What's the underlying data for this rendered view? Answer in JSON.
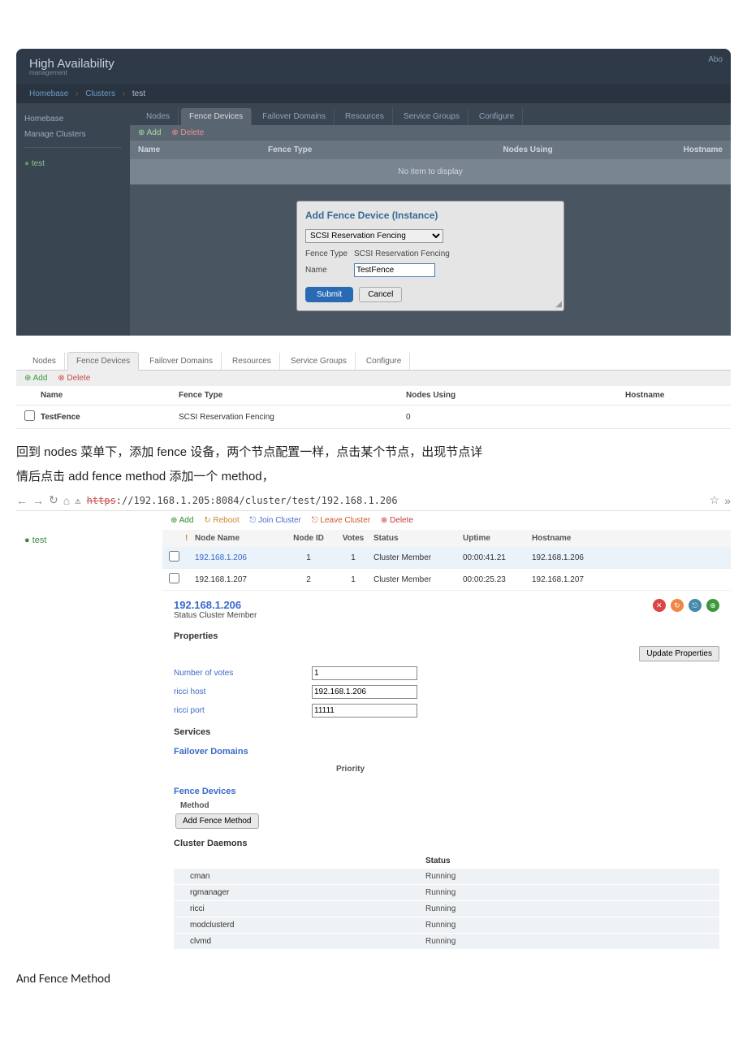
{
  "panel1": {
    "header": {
      "title": "High Availability",
      "subtitle": "management",
      "about": "Abo"
    },
    "breadcrumb": {
      "homebase": "Homebase",
      "clusters": "Clusters",
      "current": "test"
    },
    "sidebar": {
      "homebase": "Homebase",
      "manage": "Manage Clusters",
      "test": "test"
    },
    "tabs": [
      "Nodes",
      "Fence Devices",
      "Failover Domains",
      "Resources",
      "Service Groups",
      "Configure"
    ],
    "toolbar": {
      "add": "Add",
      "delete": "Delete"
    },
    "cols": {
      "name": "Name",
      "ftype": "Fence Type",
      "nodes": "Nodes Using",
      "host": "Hostname"
    },
    "no_item": "No item to display",
    "modal": {
      "title": "Add Fence Device (Instance)",
      "select": "SCSI Reservation Fencing",
      "ftype_label": "Fence Type",
      "ftype_value": "SCSI Reservation Fencing",
      "name_label": "Name",
      "name_value": "TestFence",
      "submit": "Submit",
      "cancel": "Cancel"
    }
  },
  "panel2": {
    "tabs": [
      "Nodes",
      "Fence Devices",
      "Failover Domains",
      "Resources",
      "Service Groups",
      "Configure"
    ],
    "toolbar": {
      "add": "Add",
      "delete": "Delete"
    },
    "cols": {
      "name": "Name",
      "ftype": "Fence Type",
      "nodes": "Nodes Using",
      "host": "Hostname"
    },
    "row": {
      "name": "TestFence",
      "ftype": "SCSI Reservation Fencing",
      "nodes": "0",
      "host": ""
    }
  },
  "cn1": "回到 nodes 菜单下，添加 fence 设备，两个节点配置一样，点击某个节点，出现节点详",
  "cn2": "情后点击 add fence method 添加一个 method，",
  "browser": {
    "url_pre": "https",
    "url_rest": "://192.168.1.205:8084/cluster/test/192.168.1.206"
  },
  "panel3": {
    "sidebar": {
      "test": "test"
    },
    "toolbar": {
      "add": "Add",
      "reboot": "Reboot",
      "join": "Join Cluster",
      "leave": "Leave Cluster",
      "delete": "Delete"
    },
    "ncols": {
      "name": "Node Name",
      "id": "Node ID",
      "votes": "Votes",
      "status": "Status",
      "uptime": "Uptime",
      "host": "Hostname"
    },
    "rows": [
      {
        "name": "192.168.1.206",
        "id": "1",
        "votes": "1",
        "status": "Cluster Member",
        "uptime": "00:00:41.21",
        "host": "192.168.1.206"
      },
      {
        "name": "192.168.1.207",
        "id": "2",
        "votes": "1",
        "status": "Cluster Member",
        "uptime": "00:00:25.23",
        "host": "192.168.1.207"
      }
    ],
    "detail": {
      "title": "192.168.1.206",
      "status_label": "Status",
      "status_value": "Cluster Member",
      "properties": "Properties",
      "update": "Update Properties",
      "votes_label": "Number of votes",
      "votes_value": "1",
      "host_label": "ricci host",
      "host_value": "192.168.1.206",
      "port_label": "ricci port",
      "port_value": "11111",
      "services": "Services",
      "failover": "Failover Domains",
      "priority": "Priority",
      "fence": "Fence Devices",
      "method": "Method",
      "add_method": "Add Fence Method",
      "daemons": "Cluster Daemons",
      "dstatus": "Status",
      "dlist": [
        {
          "name": "cman",
          "status": "Running"
        },
        {
          "name": "rgmanager",
          "status": "Running"
        },
        {
          "name": "ricci",
          "status": "Running"
        },
        {
          "name": "modclusterd",
          "status": "Running"
        },
        {
          "name": "clvmd",
          "status": "Running"
        }
      ]
    }
  },
  "final": "And Fence Method"
}
